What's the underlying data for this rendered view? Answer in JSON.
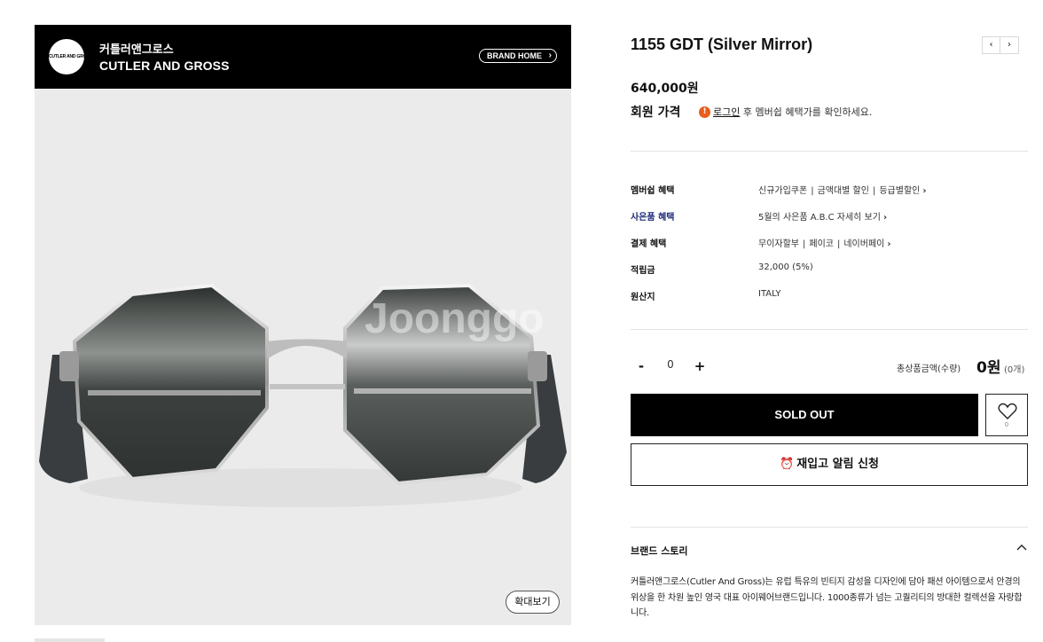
{
  "brand": {
    "logo_text": "CUTLER AND GROSS",
    "name_kr": "커틀러앤그로스",
    "name_en": "CUTLER AND GROSS",
    "home_label": "BRAND HOME"
  },
  "image": {
    "watermark": "Joonggo",
    "zoom_label": "확대보기"
  },
  "product": {
    "title": "1155 GDT (Silver Mirror)",
    "price": "640,000원",
    "member_price_label": "회원 가격",
    "info_icon": "!",
    "login_link": "로그인",
    "member_note": " 후 멤버쉽 혜택가를 확인하세요."
  },
  "nav": {
    "prev": "‹",
    "next": "›"
  },
  "benefits": {
    "membership": {
      "label": "멤버쉽 혜택",
      "items": [
        "신규가입쿠폰",
        "금액대별 할인",
        "등급별할인"
      ]
    },
    "gift": {
      "label": "사은품 혜택",
      "text": "5월의 사은품 A.B.C 자세히 보기"
    },
    "payment": {
      "label": "결제 혜택",
      "items": [
        "무이자할부",
        "페이코",
        "네이버페이"
      ]
    },
    "points": {
      "label": "적립금",
      "value": "32,000 (5%)"
    },
    "origin": {
      "label": "원산지",
      "value": "ITALY"
    }
  },
  "quantity": {
    "minus": "-",
    "value": "0",
    "plus": "+",
    "total_label": "총상품금액(수량)",
    "total_price": "0원",
    "total_count": "(0개)"
  },
  "actions": {
    "sold_out": "SOLD OUT",
    "wish_count": "0",
    "restock_icon": "⏰",
    "restock_label": "재입고 알림 신청"
  },
  "story": {
    "title": "브랜드 스토리",
    "text": "커틀러앤그로스(Cutler And Gross)는 유럽 특유의 빈티지 감성을 디자인에 담아 패션 아이템으로서 안경의 위상을 한 차원 높인 영국 대표 아이웨어브랜드입니다. 1000종류가 넘는 고퀄리티의 방대한 컬렉션을 자랑합니다."
  },
  "colors": {
    "brand_bar": "#000000",
    "image_bg": "#ebebeb",
    "gift_label": "#1f2a78",
    "info_icon": "#e85d1c"
  }
}
